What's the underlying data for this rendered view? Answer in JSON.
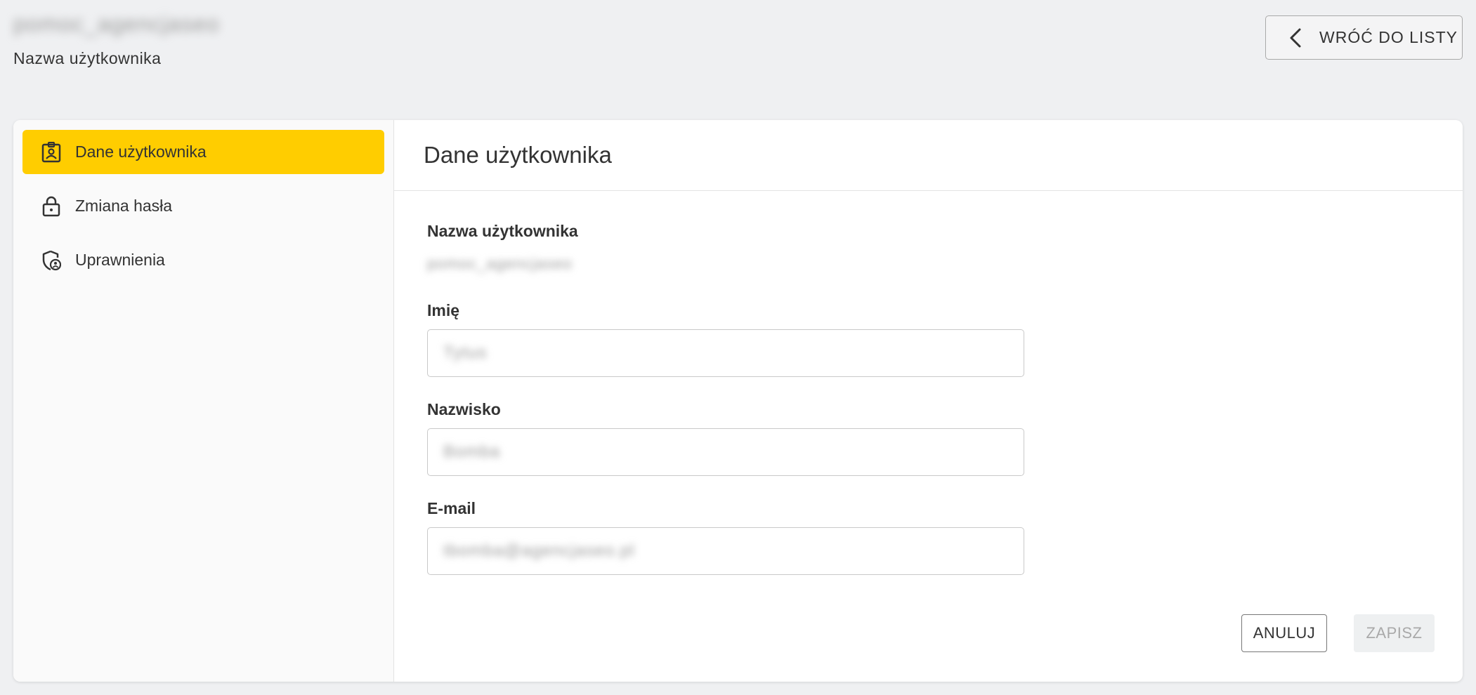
{
  "header": {
    "username": "pomoc_agencjaseo",
    "username_caption": "Nazwa użytkownika",
    "back_button_label": "WRÓĆ DO LISTY"
  },
  "sidebar": {
    "items": [
      {
        "label": "Dane użytkownika",
        "icon": "badge-icon",
        "active": true
      },
      {
        "label": "Zmiana hasła",
        "icon": "lock-icon",
        "active": false
      },
      {
        "label": "Uprawnienia",
        "icon": "shield-user-icon",
        "active": false
      }
    ]
  },
  "main": {
    "title": "Dane użytkownika",
    "username_label": "Nazwa użytkownika",
    "username_value": "pomoc_agencjaseo",
    "first_name_label": "Imię",
    "first_name_value": "Tytus",
    "last_name_label": "Nazwisko",
    "last_name_value": "Bomba",
    "email_label": "E-mail",
    "email_value": "tbomba@agencjaseo.pl"
  },
  "actions": {
    "cancel_label": "ANULUJ",
    "save_label": "ZAPISZ"
  },
  "colors": {
    "accent": "#ffcd00",
    "background": "#eff0f2"
  }
}
